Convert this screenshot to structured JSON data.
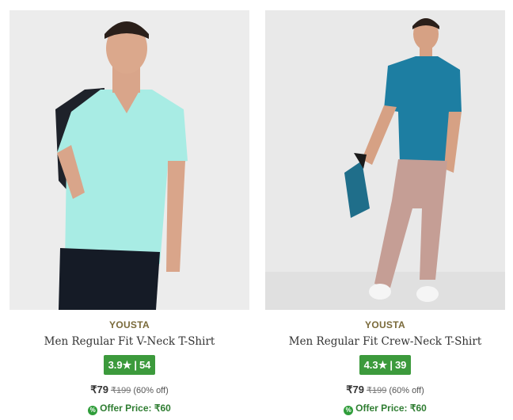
{
  "products": [
    {
      "brand": "YOUSTA",
      "title": "Men Regular Fit V-Neck T-Shirt",
      "rating": "3.9",
      "rating_star": "★",
      "reviews": "54",
      "price": "₹79",
      "mrp": "₹199",
      "discount": "(60% off)",
      "offer_label": "Offer Price: ₹60",
      "image_name": "model wearing mint v-neck t-shirt",
      "shirt_color": "#a8ece4"
    },
    {
      "brand": "YOUSTA",
      "title": "Men Regular Fit Crew-Neck T-Shirt",
      "rating": "4.3",
      "rating_star": "★",
      "reviews": "39",
      "price": "₹79",
      "mrp": "₹199",
      "discount": "(60% off)",
      "offer_label": "Offer Price: ₹60",
      "image_name": "model wearing teal crew-neck t-shirt",
      "shirt_color": "#1d7ea2"
    }
  ],
  "colors": {
    "rating_badge": "#3c9a3c",
    "brand_text": "#7a6a3a",
    "offer_text": "#2f7d32"
  }
}
